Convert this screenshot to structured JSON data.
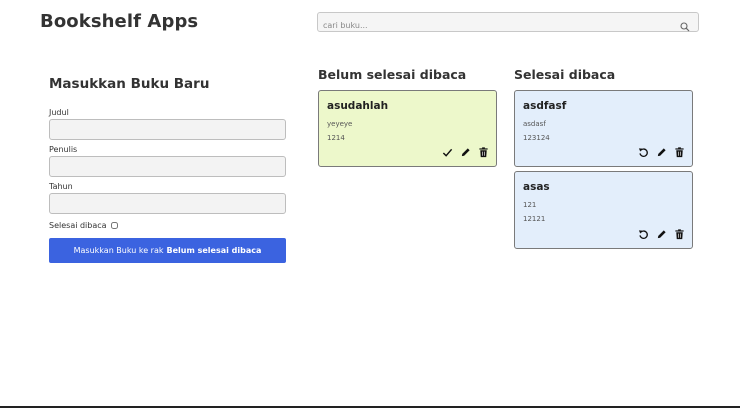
{
  "header": {
    "title": "Bookshelf Apps"
  },
  "search": {
    "placeholder": "cari buku...",
    "icon": "search-icon"
  },
  "form": {
    "title": "Masukkan Buku Baru",
    "title_label": "Judul",
    "author_label": "Penulis",
    "year_label": "Tahun",
    "finished_label": "Selesai dibaca",
    "submit_prefix": "Masukkan Buku ke rak",
    "submit_target": "Belum selesai dibaca",
    "submit_color": "#3b63e0"
  },
  "unread_shelf": {
    "title": "Belum selesai dibaca",
    "card_color": "#edf8cb",
    "books": [
      {
        "title": "asudahlah",
        "author": "yeyeye",
        "year": "1214"
      }
    ]
  },
  "read_shelf": {
    "title": "Selesai dibaca",
    "card_color": "#e3eefb",
    "books": [
      {
        "title": "asdfasf",
        "author": "asdasf",
        "year": "123124"
      },
      {
        "title": "asas",
        "author": "121",
        "year": "12121"
      }
    ]
  }
}
